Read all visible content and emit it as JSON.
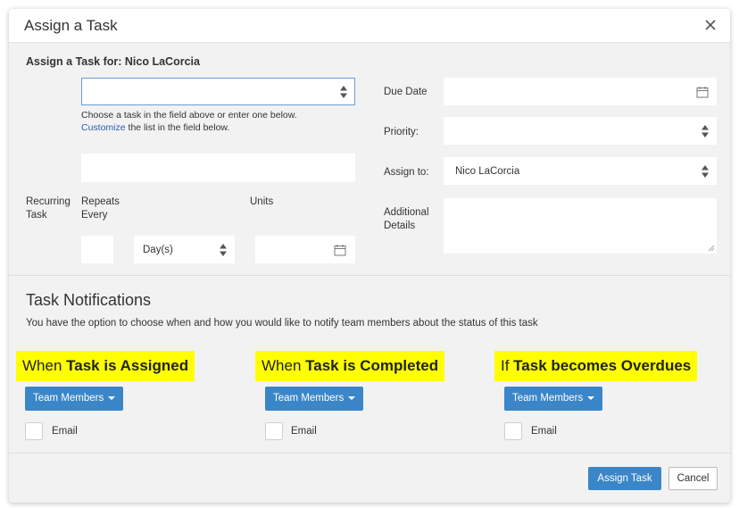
{
  "header": {
    "title": "Assign a Task",
    "close_icon": "close-icon"
  },
  "form": {
    "assign_for_label": "Assign a Task for: Nico LaCorcia",
    "task_select_value": "",
    "helper_line1": "Choose a task in the field above or enter one below.",
    "helper_link": "Customize",
    "helper_line2_rest": " the list in the field below.",
    "task_text_value": "",
    "recurring_label_1": "Recurring",
    "recurring_label_2": "Task",
    "repeats_label_1": "Repeats",
    "repeats_label_2": "Every",
    "units_label": "Units",
    "repeats_value": "",
    "period_value": "Day(s)",
    "units_value": "",
    "due_date_label": "Due Date",
    "due_date_value": "",
    "priority_label": "Priority:",
    "priority_value": "",
    "assign_to_label": "Assign to:",
    "assign_to_value": "Nico LaCorcia",
    "additional_label_1": "Additional",
    "additional_label_2": "Details",
    "additional_value": ""
  },
  "notifications": {
    "title": "Task Notifications",
    "description": "You have the option to choose when and how you would like to notify team members about the status of this task",
    "columns": [
      {
        "prefix": "When ",
        "bold": "Task is Assigned",
        "button": "Team Members",
        "checkbox_label": "Email"
      },
      {
        "prefix": "When ",
        "bold": "Task is Completed",
        "button": "Team Members",
        "checkbox_label": "Email"
      },
      {
        "prefix": "If ",
        "bold": "Task becomes Overdues",
        "button": "Team Members",
        "checkbox_label": "Email"
      }
    ]
  },
  "footer": {
    "assign_label": "Assign Task",
    "cancel_label": "Cancel"
  },
  "colors": {
    "primary": "#3a86c8",
    "highlight": "#ffff00",
    "link": "#2a5db0",
    "background": "#f2f2f2"
  }
}
